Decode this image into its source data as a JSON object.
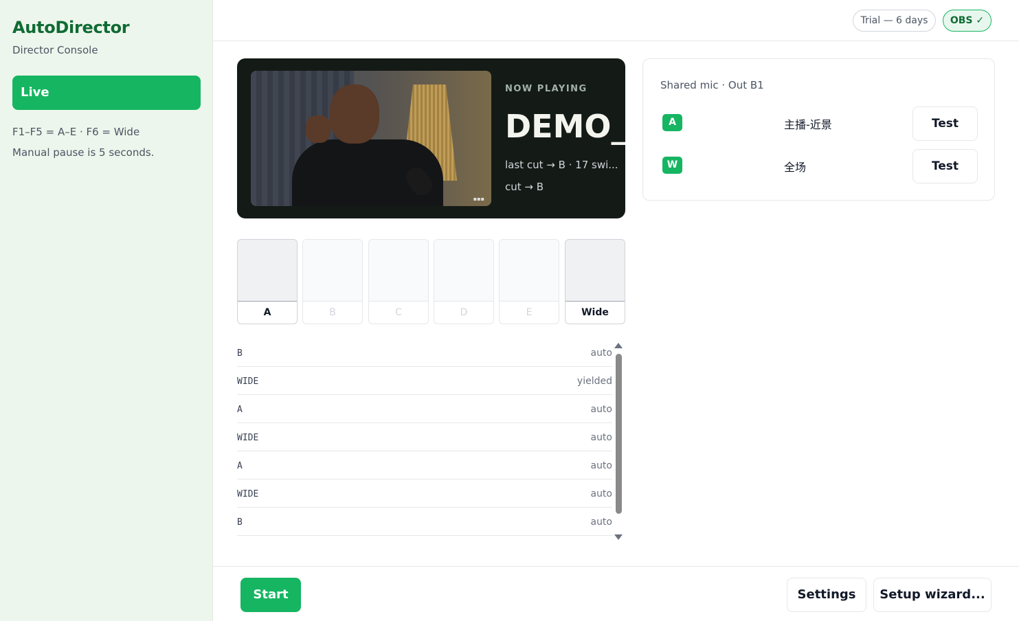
{
  "sidebar": {
    "app_title": "AutoDirector",
    "app_subtitle": "Director Console",
    "nav_live": "Live",
    "hint_keys": "F1–F5 = A–E · F6 = Wide",
    "hint_pause": "Manual pause is 5 seconds."
  },
  "header": {
    "trial": "Trial — 6 days",
    "obs": "OBS ✓"
  },
  "now_playing": {
    "label": "NOW PLAYING",
    "name": "DEMO_B",
    "meta_last_cut": "last cut → B · 17 swi...",
    "meta_cut": "cut → B",
    "thumbnail_icon": "video-frame-image"
  },
  "cameras": [
    {
      "label": "A",
      "active": true
    },
    {
      "label": "B",
      "active": false
    },
    {
      "label": "C",
      "active": false
    },
    {
      "label": "D",
      "active": false
    },
    {
      "label": "E",
      "active": false
    },
    {
      "label": "Wide",
      "active": true
    }
  ],
  "log": [
    {
      "cam": "B",
      "mode": "auto"
    },
    {
      "cam": "WIDE",
      "mode": "yielded"
    },
    {
      "cam": "A",
      "mode": "auto"
    },
    {
      "cam": "WIDE",
      "mode": "auto"
    },
    {
      "cam": "A",
      "mode": "auto"
    },
    {
      "cam": "WIDE",
      "mode": "auto"
    },
    {
      "cam": "B",
      "mode": "auto"
    }
  ],
  "mic_panel": {
    "title": "Shared mic · Out B1",
    "rows": [
      {
        "key": "A",
        "scene": "主播-近景",
        "test_label": "Test"
      },
      {
        "key": "W",
        "scene": "全场",
        "test_label": "Test"
      }
    ]
  },
  "footer": {
    "start": "Start",
    "settings": "Settings",
    "wizard": "Setup wizard..."
  },
  "colors": {
    "accent": "#16b562",
    "brand_text": "#0f6b34",
    "sidebar_bg": "#edf6ec",
    "card_bg": "#141a16"
  }
}
